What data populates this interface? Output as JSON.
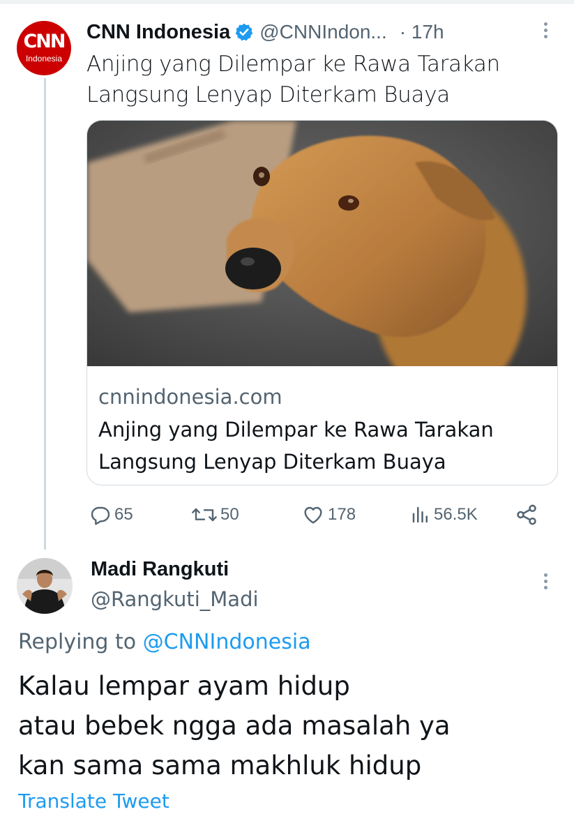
{
  "tweet": {
    "avatar": {
      "logo": "CNN",
      "sub": "Indonesia"
    },
    "display_name": "CNN Indonesia",
    "handle": "@CNNIndon...",
    "time": "· 17h",
    "text_lines": [
      "Anjing yang Dilempar ke Rawa Tarakan",
      "Langsung Lenyap Diterkam Buaya"
    ],
    "card": {
      "domain": "cnnindonesia.com",
      "title_lines": [
        "Anjing yang Dilempar ke Rawa Tarakan",
        "Langsung Lenyap Diterkam Buaya"
      ]
    },
    "actions": {
      "replies": "65",
      "retweets": "50",
      "likes": "178",
      "views": "56.5K"
    }
  },
  "reply": {
    "display_name": "Madi Rangkuti",
    "handle": "@Rangkuti_Madi",
    "replying_prefix": "Replying to ",
    "replying_handle": "@CNNIndonesia",
    "text_lines": [
      "Kalau lempar ayam hidup",
      "atau bebek ngga ada masalah ya",
      "kan sama sama makhluk hidup"
    ],
    "translate_label": "Translate Tweet"
  },
  "colors": {
    "accent": "#1d9bf0",
    "muted": "#536471",
    "text": "#0f1419",
    "border": "#cfd9de",
    "cnn_red": "#cc0000"
  }
}
